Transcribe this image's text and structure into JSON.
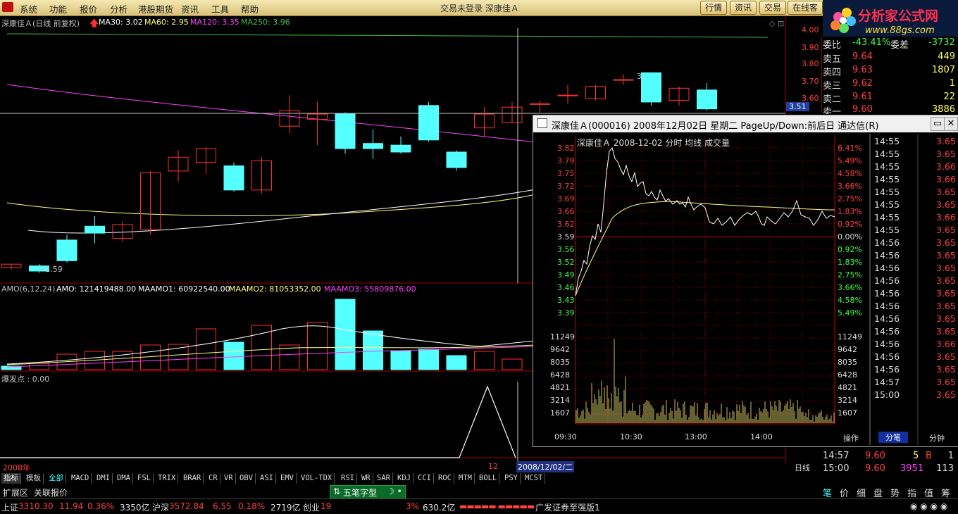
{
  "menu": {
    "items": [
      "系统",
      "功能",
      "报价",
      "分析",
      "港股期货",
      "资讯",
      "工具",
      "帮助"
    ],
    "center_text": "交易未登录    深康佳Ａ",
    "buttons": [
      "行情",
      "资讯",
      "交易",
      "在线客"
    ],
    "logo_title": "分析家公式网",
    "logo_url": "www.88gs.com"
  },
  "main_chart": {
    "title": "深康佳Ａ(日线 前复权)",
    "ma30_label": "MA30: 3.02",
    "ma60_label": "MA60: 2.95",
    "ma120_label": "MA120: 3.35",
    "ma250_label": "MA250: 3.96",
    "price_ticks": [
      "4.00",
      "3.90",
      "3.80",
      "3.70",
      "3.60",
      "3.51"
    ],
    "low_annotation": "←2.59",
    "high_annotation": "3.",
    "colors": {
      "up": "#ff3030",
      "down": "#54ffff",
      "ma30": "#ffffff",
      "ma60": "#ffff80",
      "ma120": "#ff40ff",
      "ma250": "#40c040"
    },
    "candles": [
      {
        "o": 2.62,
        "c": 2.64,
        "h": 2.64,
        "l": 2.61
      },
      {
        "o": 2.63,
        "c": 2.6,
        "h": 2.64,
        "l": 2.59
      },
      {
        "o": 2.78,
        "c": 2.66,
        "h": 2.81,
        "l": 2.65
      },
      {
        "o": 2.86,
        "c": 2.82,
        "h": 2.92,
        "l": 2.76
      },
      {
        "o": 2.79,
        "c": 2.87,
        "h": 2.89,
        "l": 2.77
      },
      {
        "o": 2.84,
        "c": 3.17,
        "h": 3.18,
        "l": 2.81
      },
      {
        "o": 3.18,
        "c": 3.26,
        "h": 3.3,
        "l": 3.12
      },
      {
        "o": 3.23,
        "c": 3.31,
        "h": 3.32,
        "l": 3.16
      },
      {
        "o": 3.21,
        "c": 3.07,
        "h": 3.23,
        "l": 3.06
      },
      {
        "o": 3.07,
        "c": 3.24,
        "h": 3.26,
        "l": 3.05
      },
      {
        "o": 3.44,
        "c": 3.53,
        "h": 3.62,
        "l": 3.4
      },
      {
        "o": 3.48,
        "c": 3.51,
        "h": 3.58,
        "l": 3.33
      },
      {
        "o": 3.51,
        "c": 3.31,
        "h": 3.52,
        "l": 3.28
      },
      {
        "o": 3.34,
        "c": 3.31,
        "h": 3.42,
        "l": 3.25
      },
      {
        "o": 3.33,
        "c": 3.29,
        "h": 3.38,
        "l": 3.28
      },
      {
        "o": 3.56,
        "c": 3.36,
        "h": 3.58,
        "l": 3.35
      },
      {
        "o": 3.29,
        "c": 3.2,
        "h": 3.3,
        "l": 3.18
      },
      {
        "o": 3.43,
        "c": 3.51,
        "h": 3.55,
        "l": 3.38
      },
      {
        "o": 3.46,
        "c": 3.55,
        "h": 3.58,
        "l": 3.46
      },
      {
        "o": 3.57,
        "c": 3.57,
        "h": 3.59,
        "l": 3.52
      },
      {
        "o": 3.62,
        "c": 3.62,
        "h": 3.68,
        "l": 3.57
      },
      {
        "o": 3.6,
        "c": 3.67,
        "h": 3.68,
        "l": 3.59
      },
      {
        "o": 3.71,
        "c": 3.71,
        "h": 3.74,
        "l": 3.68
      },
      {
        "o": 3.75,
        "c": 3.58,
        "h": 3.75,
        "l": 3.56
      },
      {
        "o": 3.59,
        "c": 3.66,
        "h": 3.67,
        "l": 3.56
      },
      {
        "o": 3.65,
        "c": 3.54,
        "h": 3.69,
        "l": 3.53
      }
    ]
  },
  "amo": {
    "label": "AMO(6,12,24)",
    "amo": "AMO: 121419488.00",
    "maamo1": "MAAMO1: 60922540.00",
    "maamo2": "MAAMO2: 81053352.00",
    "maamo3": "MAAMO3: 55809876.00",
    "bars": [
      0.05,
      0.09,
      0.22,
      0.26,
      0.26,
      0.35,
      0.36,
      0.58,
      0.39,
      0.63,
      0.35,
      0.67,
      1.0,
      0.55,
      0.27,
      0.29,
      0.2,
      0.26,
      0.15,
      0.53,
      0.65
    ]
  },
  "burst": {
    "label": "爆发点 : 0.00"
  },
  "date_axis": {
    "year": "2008年",
    "month": "12",
    "current": "2008/12/02/二",
    "period": "日线"
  },
  "quote": {
    "weibi_label": "委比",
    "weibi": "-43.41%",
    "weicha_label": "委差",
    "weicha": "-3732",
    "asks": [
      {
        "name": "卖五",
        "price": "9.64",
        "vol": "449"
      },
      {
        "name": "卖四",
        "price": "9.63",
        "vol": "1807"
      },
      {
        "name": "卖三",
        "price": "9.62",
        "vol": "1"
      },
      {
        "name": "卖二",
        "price": "9.61",
        "vol": "22"
      },
      {
        "name": "卖一",
        "price": "9.60",
        "vol": "3886"
      }
    ],
    "ticks": [
      {
        "time": "14:57",
        "price": "9.60",
        "vol": "5",
        "bs": "B",
        "n": "1"
      },
      {
        "time": "15:00",
        "price": "9.60",
        "vol": "3951",
        "bs": "",
        "n": "113"
      }
    ]
  },
  "popup": {
    "title": "深康佳Ａ(000016) 2008年12月02日 星期二 PageUp/Down:前后日 通达信(R)",
    "subtitle": "深康佳Ａ    2008-12-02 分时  均线  成交量",
    "left_prices": [
      "3.82",
      "3.79",
      "3.75",
      "3.72",
      "3.69",
      "3.66",
      "3.62",
      "3.59",
      "3.56",
      "3.52",
      "3.49",
      "3.46",
      "3.43",
      "3.39"
    ],
    "right_pcts": [
      "6.41%",
      "5.49%",
      "4.58%",
      "3.66%",
      "2.75%",
      "1.83%",
      "0.92%",
      "0.00%",
      "0.92%",
      "1.83%",
      "2.75%",
      "3.66%",
      "4.58%",
      "5.49%"
    ],
    "vol_ticks": [
      "11249",
      "9642",
      "8035",
      "6428",
      "4821",
      "3214",
      "1607"
    ],
    "time_labels": [
      "09:30",
      "10:30",
      "13:00",
      "14:00"
    ],
    "tick_list": [
      {
        "t": "14:55",
        "p": "3.65"
      },
      {
        "t": "14:55",
        "p": "3.65"
      },
      {
        "t": "14:55",
        "p": "3.66"
      },
      {
        "t": "14:55",
        "p": "3.66"
      },
      {
        "t": "14:55",
        "p": "3.65"
      },
      {
        "t": "14:55",
        "p": "3.65"
      },
      {
        "t": "14:55",
        "p": "3.66"
      },
      {
        "t": "14:55",
        "p": "3.65"
      },
      {
        "t": "14:56",
        "p": "3.65"
      },
      {
        "t": "14:56",
        "p": "3.65"
      },
      {
        "t": "14:56",
        "p": "3.65"
      },
      {
        "t": "14:56",
        "p": "3.65"
      },
      {
        "t": "14:56",
        "p": "3.65"
      },
      {
        "t": "14:56",
        "p": "3.65"
      },
      {
        "t": "14:56",
        "p": "3.65"
      },
      {
        "t": "14:56",
        "p": "3.65"
      },
      {
        "t": "14:56",
        "p": "3.66"
      },
      {
        "t": "14:56",
        "p": "3.65"
      },
      {
        "t": "14:56",
        "p": "3.65"
      },
      {
        "t": "14:57",
        "p": "3.65"
      },
      {
        "t": "15:00",
        "p": "3.65"
      }
    ],
    "tabs": [
      "操作",
      "分笔",
      "分钟"
    ]
  },
  "indicator_tabs": [
    "指标",
    "模板",
    "全部",
    "MACD",
    "DMI",
    "DMA",
    "FSL",
    "TRIX",
    "BRAR",
    "CR",
    "VR",
    "OBV",
    "ASI",
    "EMV",
    "VOL-TDX",
    "RSI",
    "WR",
    "SAR",
    "KDJ",
    "CCI",
    "ROC",
    "MTM",
    "BOLL",
    "PSY",
    "MCST"
  ],
  "second_row": {
    "expand": "扩展区",
    "related": "关联报价",
    "ime": "五笔字型",
    "ime_mode": "简"
  },
  "right_tabs": [
    "笔",
    "价",
    "细",
    "盘",
    "势",
    "指",
    "值",
    "筹"
  ],
  "status": {
    "sh_label": "上证",
    "sh_val": "3310.30",
    "sh_chg": "11.94",
    "sh_pct": "0.36%",
    "sh_amt": "3350亿",
    "hs_label": "沪深",
    "hs_val": "3572.84",
    "hs_chg": "6.55",
    "hs_pct": "0.18%",
    "hs_amt": "2719亿",
    "cy_label": "创业",
    "cy_val": "19",
    "cy_pct": "3%",
    "cy_amt": "630.2亿",
    "broker": "广发证券至强版1"
  }
}
